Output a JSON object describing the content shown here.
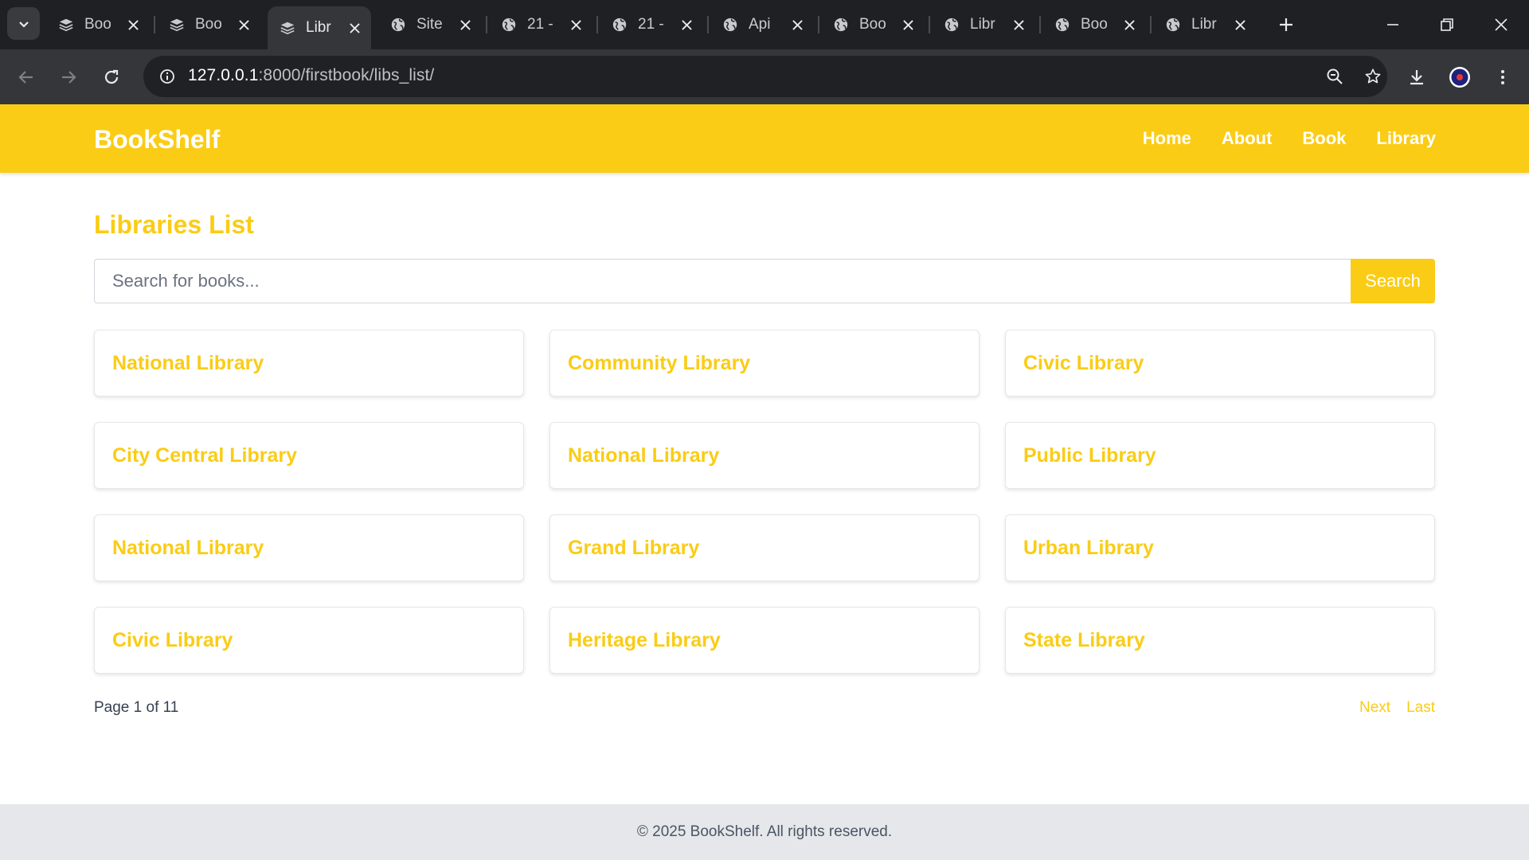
{
  "browser": {
    "tabs": [
      {
        "title": "Boo",
        "icon": "stack-icon",
        "active": false
      },
      {
        "title": "Boo",
        "icon": "stack-icon",
        "active": false
      },
      {
        "title": "Libr",
        "icon": "stack-icon",
        "active": true
      },
      {
        "title": "Site",
        "icon": "globe-icon",
        "active": false
      },
      {
        "title": "21 -",
        "icon": "globe-icon",
        "active": false
      },
      {
        "title": "21 -",
        "icon": "globe-icon",
        "active": false
      },
      {
        "title": "Api",
        "icon": "globe-icon",
        "active": false
      },
      {
        "title": "Boo",
        "icon": "globe-icon",
        "active": false
      },
      {
        "title": "Libr",
        "icon": "globe-icon",
        "active": false
      },
      {
        "title": "Boo",
        "icon": "globe-icon",
        "active": false
      },
      {
        "title": "Libr",
        "icon": "globe-icon",
        "active": false
      }
    ],
    "url_host": "127.0.0.1",
    "url_path": ":8000/firstbook/libs_list/"
  },
  "site": {
    "brand": "BookShelf",
    "nav": [
      "Home",
      "About",
      "Book",
      "Library"
    ],
    "accent_color": "#facc15"
  },
  "main": {
    "heading": "Libraries List",
    "search_placeholder": "Search for books...",
    "search_button": "Search",
    "libraries": [
      "National Library",
      "Community Library",
      "Civic Library",
      "City Central Library",
      "National Library",
      "Public Library",
      "National Library",
      "Grand Library",
      "Urban Library",
      "Civic Library",
      "Heritage Library",
      "State Library"
    ],
    "page_info": "Page 1 of 11",
    "pager": {
      "next": "Next",
      "last": "Last"
    }
  },
  "footer": {
    "text": "© 2025 BookShelf. All rights reserved."
  }
}
